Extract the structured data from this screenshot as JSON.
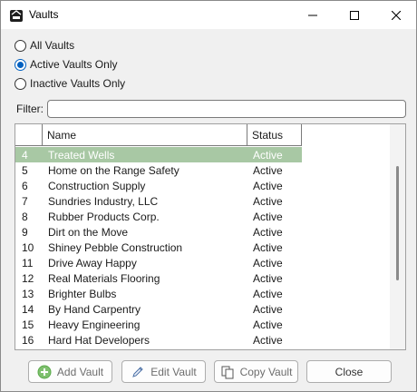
{
  "window": {
    "title": "Vaults",
    "icon": "vault-app-icon",
    "controls": [
      "minimize-icon",
      "maximize-icon",
      "close-icon"
    ]
  },
  "filter_options": {
    "all": {
      "label": "All Vaults",
      "checked": false
    },
    "active": {
      "label": "Active Vaults Only",
      "checked": true
    },
    "inactive": {
      "label": "Inactive Vaults Only",
      "checked": false
    }
  },
  "filter": {
    "label": "Filter:",
    "value": "",
    "placeholder": ""
  },
  "grid": {
    "columns": {
      "index": "",
      "name": "Name",
      "status": "Status"
    },
    "rows": [
      {
        "idx": "4",
        "name": "Treated Wells",
        "status": "Active",
        "selected": true
      },
      {
        "idx": "5",
        "name": "Home on the Range Safety",
        "status": "Active"
      },
      {
        "idx": "6",
        "name": "Construction Supply",
        "status": "Active"
      },
      {
        "idx": "7",
        "name": "Sundries Industry, LLC",
        "status": "Active"
      },
      {
        "idx": "8",
        "name": "Rubber Products Corp.",
        "status": "Active"
      },
      {
        "idx": "9",
        "name": "Dirt on the Move",
        "status": "Active"
      },
      {
        "idx": "10",
        "name": "Shiney Pebble Construction",
        "status": "Active"
      },
      {
        "idx": "11",
        "name": "Drive Away Happy",
        "status": "Active"
      },
      {
        "idx": "12",
        "name": "Real Materials Flooring",
        "status": "Active"
      },
      {
        "idx": "13",
        "name": "Brighter Bulbs",
        "status": "Active"
      },
      {
        "idx": "14",
        "name": "By Hand Carpentry",
        "status": "Active"
      },
      {
        "idx": "15",
        "name": "Heavy Engineering",
        "status": "Active"
      },
      {
        "idx": "16",
        "name": "Hard Hat Developers",
        "status": "Active"
      }
    ]
  },
  "buttons": {
    "add": "Add Vault",
    "edit": "Edit Vault",
    "copy": "Copy Vault",
    "close": "Close"
  },
  "colors": {
    "selected_row": "#a8c8a4",
    "radio_accent": "#0060c0",
    "add_icon": "#5aaa4a"
  }
}
